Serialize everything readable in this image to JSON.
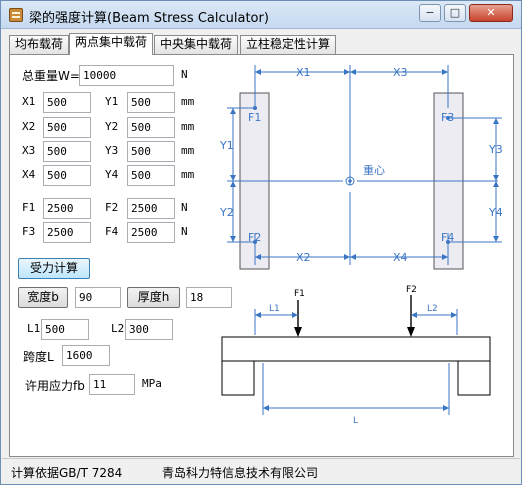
{
  "window": {
    "title": "梁的强度计算(Beam Stress Calculator)",
    "min_label": "−",
    "max_label": "□",
    "close_label": "✕"
  },
  "tabs": [
    {
      "label": "均布载荷"
    },
    {
      "label": "两点集中载荷"
    },
    {
      "label": "中央集中载荷"
    },
    {
      "label": "立柱稳定性计算"
    }
  ],
  "form": {
    "total_weight": {
      "label": "总重量W=",
      "value": "10000",
      "unit": "N"
    },
    "coords": [
      {
        "xl": "X1",
        "x": "500",
        "yl": "Y1",
        "y": "500",
        "unit": "mm"
      },
      {
        "xl": "X2",
        "x": "500",
        "yl": "Y2",
        "y": "500",
        "unit": "mm"
      },
      {
        "xl": "X3",
        "x": "500",
        "yl": "Y3",
        "y": "500",
        "unit": "mm"
      },
      {
        "xl": "X4",
        "x": "500",
        "yl": "Y4",
        "y": "500",
        "unit": "mm"
      }
    ],
    "forces": [
      {
        "al": "F1",
        "a": "2500",
        "bl": "F2",
        "b": "2500",
        "unit": "N"
      },
      {
        "al": "F3",
        "a": "2500",
        "bl": "F4",
        "b": "2500",
        "unit": "N"
      }
    ],
    "calc_button": "受力计算",
    "width": {
      "button": "宽度b",
      "value": "90"
    },
    "thickness": {
      "button": "厚度h",
      "value": "18"
    },
    "l1": {
      "label": "L1",
      "value": "500"
    },
    "l2": {
      "label": "L2",
      "value": "300"
    },
    "span": {
      "label": "跨度L",
      "value": "1600"
    },
    "allow_stress": {
      "label": "许用应力fb",
      "value": "11",
      "unit": "MPa"
    }
  },
  "top_diagram": {
    "labels": {
      "x1": "X1",
      "x2": "X2",
      "x3": "X3",
      "x4": "X4",
      "y1": "Y1",
      "y2": "Y2",
      "y3": "Y3",
      "y4": "Y4",
      "f1": "F1",
      "f2": "F2",
      "f3": "F3",
      "f4": "F4",
      "center": "重心"
    }
  },
  "beam_diagram": {
    "labels": {
      "f1": "F1",
      "f2": "F2",
      "l1": "L1",
      "l2": "L2",
      "l": "L"
    }
  },
  "status": {
    "standard": "计算依据GB/T 7284",
    "company": "青岛科力特信息技术有限公司"
  },
  "colors": {
    "diagram_line": "#3b76c4",
    "panel_fill": "#ececf2",
    "calc_button_border": "#3c7fb1"
  }
}
